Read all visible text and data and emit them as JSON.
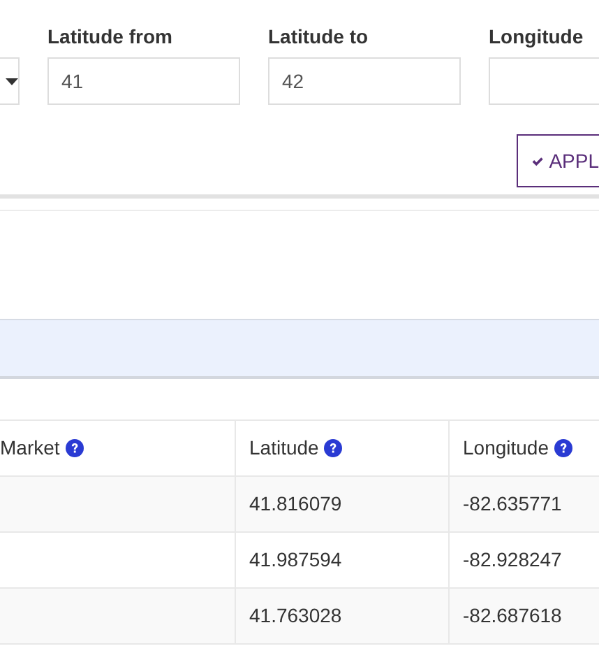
{
  "filters": [
    {
      "label": "Latitude from",
      "value": "41"
    },
    {
      "label": "Latitude to",
      "value": "42"
    },
    {
      "label": "Longitude"
    }
  ],
  "apply_button": {
    "label": "APPL"
  },
  "table": {
    "columns": [
      {
        "label": "Market"
      },
      {
        "label": "Latitude"
      },
      {
        "label": "Longitude"
      }
    ],
    "rows": [
      {
        "latitude": "41.816079",
        "longitude": "-82.635771"
      },
      {
        "latitude": "41.987594",
        "longitude": "-82.928247"
      },
      {
        "latitude": "41.763028",
        "longitude": "-82.687618"
      }
    ]
  }
}
